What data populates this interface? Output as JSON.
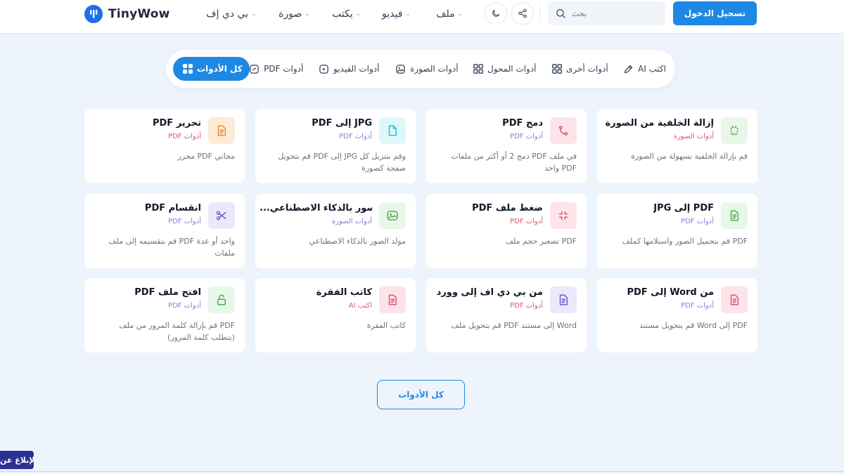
{
  "header": {
    "logo_text": "TinyWow",
    "nav": [
      {
        "label": "بي دي إف"
      },
      {
        "label": "صورة"
      },
      {
        "label": "يكتب"
      },
      {
        "label": "فيديو"
      },
      {
        "label": "ملف"
      }
    ],
    "search_placeholder": "بحث",
    "login_label": "تسجيل الدخول"
  },
  "tabs": [
    {
      "label": "كل الأدوات",
      "icon": "grid-icon",
      "active": true
    },
    {
      "label": "PDF أدوات",
      "icon": "pdf-icon"
    },
    {
      "label": "أدوات الفيديو",
      "icon": "video-icon"
    },
    {
      "label": "أدوات الصورة",
      "icon": "image-icon"
    },
    {
      "label": "أدوات المحول",
      "icon": "grid-icon"
    },
    {
      "label": "أدوات أخرى",
      "icon": "grid-icon"
    },
    {
      "label": "AI اكتب",
      "icon": "pencil-icon"
    }
  ],
  "cards": [
    {
      "title": "إزالة الخلفية من الصورة",
      "category": "أدوات الصورة",
      "desc": "قم بإزالة الخلفية بسهولة من الصورة",
      "icon": "remove-bg-icon",
      "color": "#4caf50",
      "bg": "#e8f7e9",
      "cat_color": "#e0566f"
    },
    {
      "title": "PDF دمج",
      "category": "PDF أدوات",
      "desc": "في ملف PDF دمج 2 أو أكثر من ملفات PDF واحد",
      "icon": "merge-icon",
      "color": "#e0566f",
      "bg": "#fde4ea",
      "cat_color": "#8b7fd8"
    },
    {
      "title": "PDF إلى JPG",
      "category": "PDF أدوات",
      "desc": "وقم بتنزيل كل JPG إلى PDF قم بتحويل صفحة كصورة",
      "icon": "file-icon",
      "color": "#22c3d6",
      "bg": "#e0f7fa",
      "cat_color": "#8b7fd8"
    },
    {
      "title": "PDF تحرير",
      "category": "PDF أدوات",
      "desc": "مجاني PDF محرر",
      "icon": "document-icon",
      "color": "#f08c2e",
      "bg": "#fdebd7",
      "cat_color": "#e0566f"
    },
    {
      "title": "JPG إلى PDF",
      "category": "PDF أدوات",
      "desc": "PDF قم بتحميل الصور واستلامها كملف",
      "icon": "document-icon",
      "color": "#4caf50",
      "bg": "#e8f7e9",
      "cat_color": "#8b7fd8"
    },
    {
      "title": "PDF ضغط ملف",
      "category": "PDF أدوات",
      "desc": "PDF تصغير حجم ملف",
      "icon": "compress-icon",
      "color": "#e0566f",
      "bg": "#fde4ea",
      "cat_color": "#e0566f"
    },
    {
      "title": "...لصور بالذكاء الاصطناعي",
      "category": "أدوات الصورة",
      "desc": "مولد الصور بالذكاء الاصطناعي",
      "icon": "image-icon",
      "color": "#4caf50",
      "bg": "#e8f7e9",
      "cat_color": "#8b7fd8"
    },
    {
      "title": "PDF انقسام",
      "category": "PDF أدوات",
      "desc": "واحد أو عدة PDF قم بتقسيمه إلى ملف ملفات",
      "icon": "scissors-icon",
      "color": "#6b5fd0",
      "bg": "#ebe8fb",
      "cat_color": "#8b7fd8"
    },
    {
      "title": "PDF إلى Word من",
      "category": "PDF أدوات",
      "desc": "PDF إلى Word قم بتحويل مستند",
      "icon": "document-icon",
      "color": "#e0566f",
      "bg": "#fde4ea",
      "cat_color": "#8b7fd8"
    },
    {
      "title": "من بي دي اف إلى وورد",
      "category": "PDF أدوات",
      "desc": "Word إلى مستند PDF قم بتحويل ملف",
      "icon": "document-icon",
      "color": "#6b5fd0",
      "bg": "#ebe8fb",
      "cat_color": "#e0566f"
    },
    {
      "title": "كاتب الفقرة",
      "category": "AI اكتب",
      "desc": "كاتب الفقرة",
      "icon": "document-icon",
      "color": "#e0566f",
      "bg": "#fde4ea",
      "cat_color": "#e0566f"
    },
    {
      "title": "PDF افتح ملف",
      "category": "PDF أدوات",
      "desc": "PDF قم بإزالة كلمة المرور من ملف (يتطلب كلمة المرور)",
      "icon": "unlock-icon",
      "color": "#4caf50",
      "bg": "#e8f7e9",
      "cat_color": "#8b7fd8"
    }
  ],
  "all_tools_label": "كل الأدوات",
  "report_label": "الإبلاغ عن"
}
